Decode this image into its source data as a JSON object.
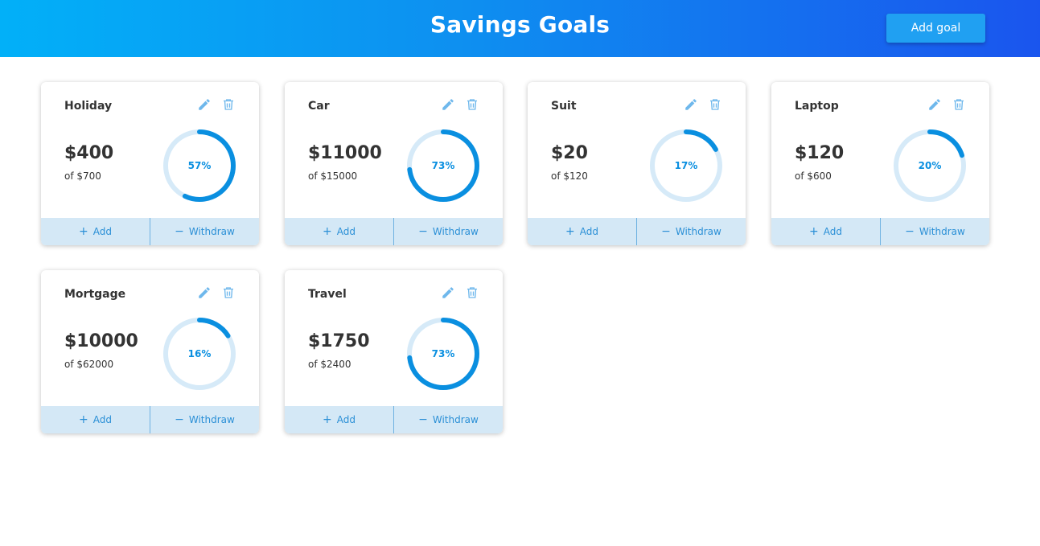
{
  "header": {
    "title": "Savings Goals",
    "add_goal_label": "Add goal"
  },
  "colors": {
    "header_start": "#02b0f8",
    "header_end": "#1a55ee",
    "accent": "#0a8fe0",
    "ring_track": "#d6eaf8",
    "actions_bg": "#d4e8f6"
  },
  "goals": [
    {
      "name": "Holiday",
      "amount": "$400",
      "target": "of $700",
      "percent_label": "57%",
      "progress": 0.57,
      "add_label": "Add",
      "withdraw_label": "Withdraw"
    },
    {
      "name": "Car",
      "amount": "$11000",
      "target": "of $15000",
      "percent_label": "73%",
      "progress": 0.73,
      "add_label": "Add",
      "withdraw_label": "Withdraw"
    },
    {
      "name": "Suit",
      "amount": "$20",
      "target": "of $120",
      "percent_label": "17%",
      "progress": 0.17,
      "add_label": "Add",
      "withdraw_label": "Withdraw"
    },
    {
      "name": "Laptop",
      "amount": "$120",
      "target": "of $600",
      "percent_label": "20%",
      "progress": 0.2,
      "add_label": "Add",
      "withdraw_label": "Withdraw"
    },
    {
      "name": "Mortgage",
      "amount": "$10000",
      "target": "of $62000",
      "percent_label": "16%",
      "progress": 0.16,
      "add_label": "Add",
      "withdraw_label": "Withdraw"
    },
    {
      "name": "Travel",
      "amount": "$1750",
      "target": "of $2400",
      "percent_label": "73%",
      "progress": 0.73,
      "add_label": "Add",
      "withdraw_label": "Withdraw"
    }
  ],
  "icons": {
    "edit": "pencil-icon",
    "delete": "trash-icon",
    "add": "plus-icon",
    "withdraw": "minus-icon"
  }
}
